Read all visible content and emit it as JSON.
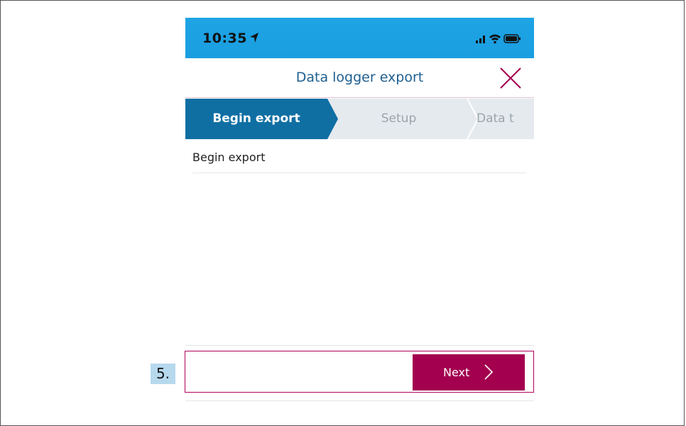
{
  "status_bar": {
    "time": "10:35",
    "location_icon": "location-arrow-icon",
    "signal_icon": "cellular-signal-icon",
    "wifi_icon": "wifi-icon",
    "battery_icon": "battery-icon"
  },
  "header": {
    "title": "Data logger export",
    "close_icon": "close-icon"
  },
  "stepper": {
    "steps": [
      {
        "label": "Begin export",
        "state": "active"
      },
      {
        "label": "Setup",
        "state": "inactive"
      },
      {
        "label": "Data t",
        "state": "inactive"
      }
    ]
  },
  "content": {
    "section_label": "Begin export"
  },
  "footer": {
    "next_label": "Next",
    "next_icon": "chevron-right-icon"
  },
  "annotation": {
    "step_number": "5."
  },
  "colors": {
    "status_bar": "#1ba1e2",
    "title_text": "#1f5f8f",
    "accent_magenta": "#a3004f",
    "active_step": "#0f6fa3",
    "inactive_step": "#e5eaee",
    "marker_bg": "#b7d9ee"
  }
}
